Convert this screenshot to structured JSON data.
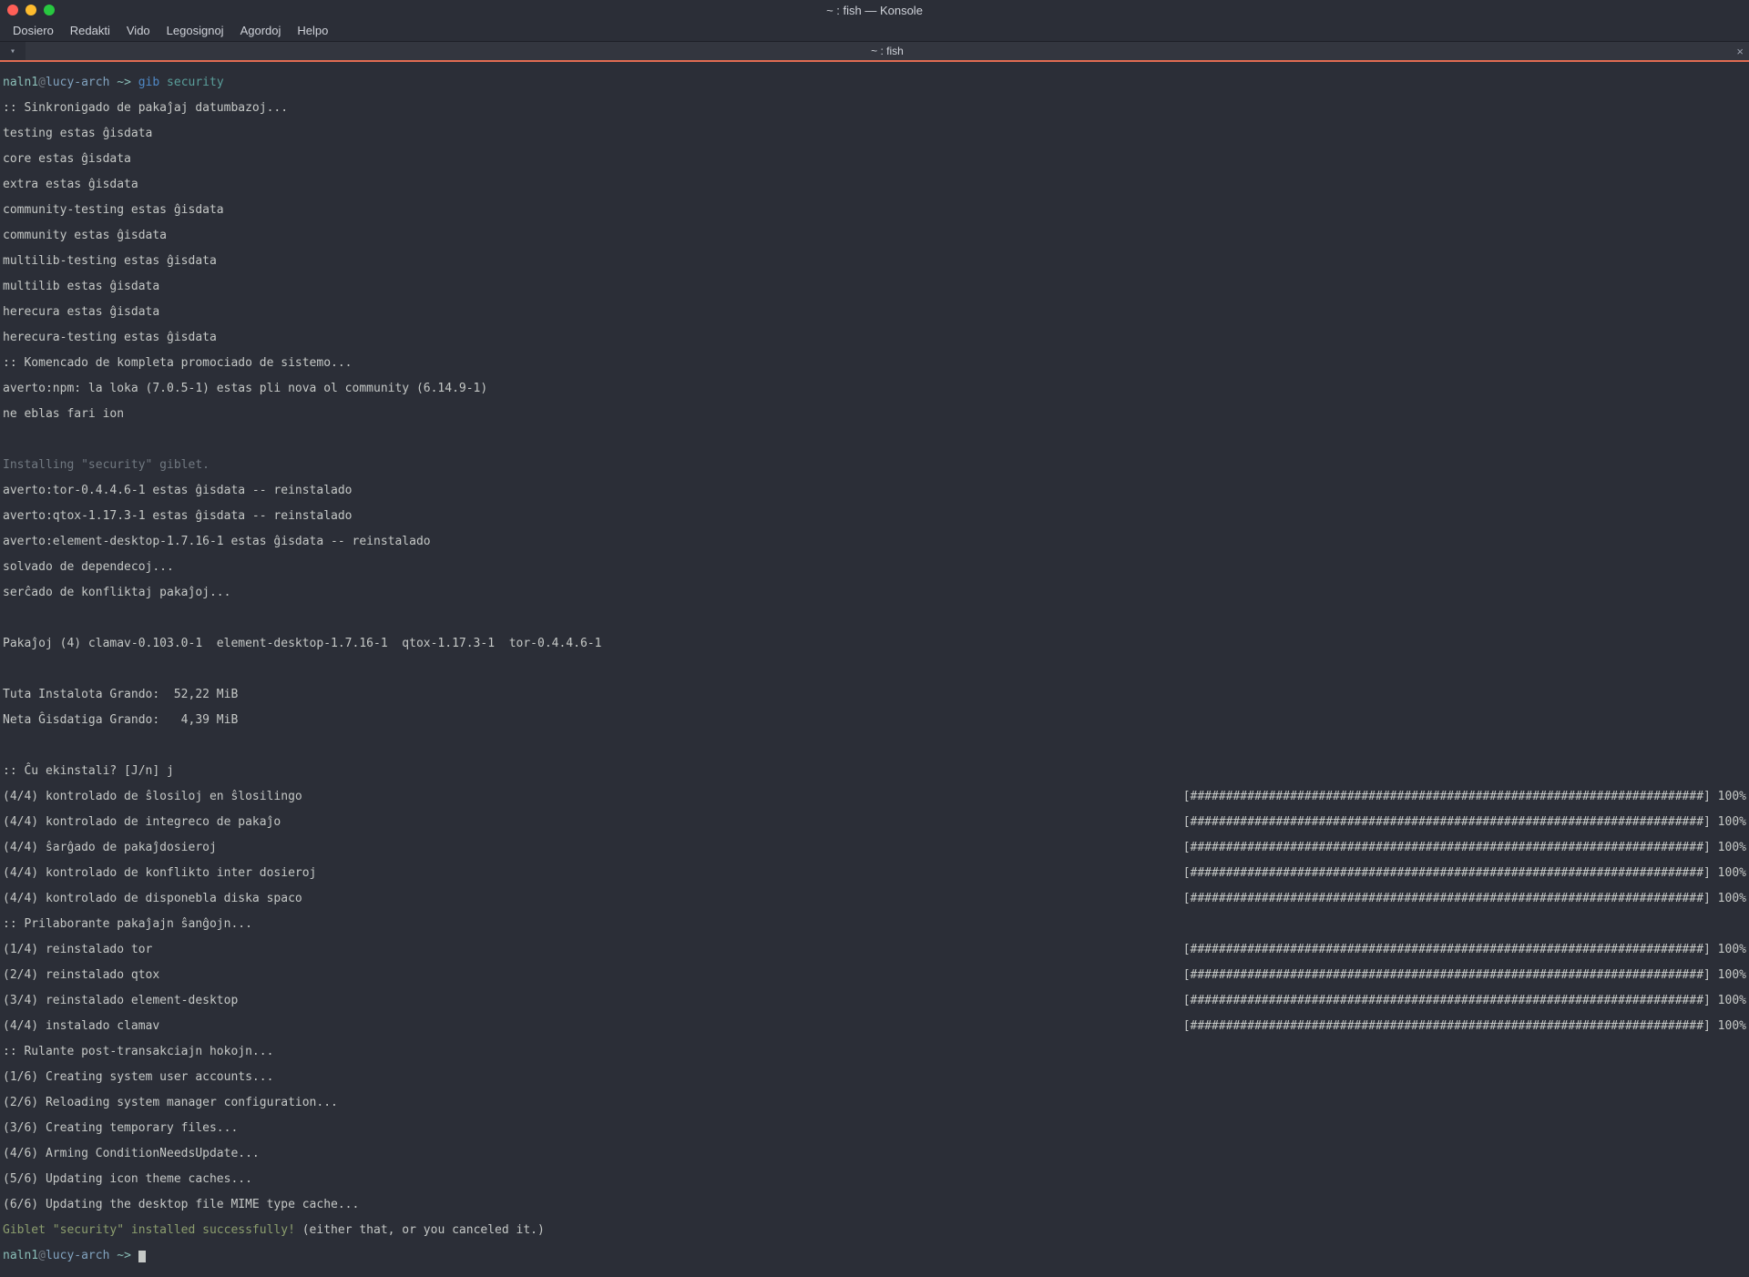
{
  "window": {
    "title": "~ : fish — Konsole"
  },
  "menubar": {
    "items": [
      "Dosiero",
      "Redakti",
      "Vido",
      "Legosignoj",
      "Agordoj",
      "Helpo"
    ]
  },
  "tabbar": {
    "newtab_glyph": "▾",
    "tab_label": "~ : fish",
    "close_glyph": "×"
  },
  "prompt": {
    "user": "naln1",
    "at": "@",
    "host": "lucy-arch",
    "sep": " ~> ",
    "cmd1": "gib",
    "cmd2": " security"
  },
  "output": {
    "sync": ":: Sinkronigado de pakaĵaj datumbazoj...",
    "repos": [
      "testing estas ĝisdata",
      "core estas ĝisdata",
      "extra estas ĝisdata",
      "community-testing estas ĝisdata",
      "community estas ĝisdata",
      "multilib-testing estas ĝisdata",
      "multilib estas ĝisdata",
      "herecura estas ĝisdata",
      "herecura-testing estas ĝisdata"
    ],
    "upgradestart": ":: Komencado de kompleta promociado de sistemo...",
    "npmwarn": "averto:npm: la loka (7.0.5-1) estas pli nova ol community (6.14.9-1)",
    "nothing": "ne eblas fari ion",
    "installing_header": "Installing \"security\" giblet.",
    "warn_tor": "averto:tor-0.4.4.6-1 estas ĝisdata -- reinstalado",
    "warn_qtox": "averto:qtox-1.17.3-1 estas ĝisdata -- reinstalado",
    "warn_element": "averto:element-desktop-1.7.16-1 estas ĝisdata -- reinstalado",
    "resolve": "solvado de dependecoj...",
    "conflicts": "serĉado de konfliktaj pakaĵoj...",
    "packages": "Pakaĵoj (4) clamav-0.103.0-1  element-desktop-1.7.16-1  qtox-1.17.3-1  tor-0.4.4.6-1",
    "totalsize": "Tuta Instalota Grando:  52,22 MiB",
    "netsize": "Neta Ĝisdatiga Grando:   4,39 MiB",
    "proceed": ":: Ĉu ekinstali? [J/n] j",
    "checks": [
      "(4/4) kontrolado de ŝlosiloj en ŝlosilingo",
      "(4/4) kontrolado de integreco de pakaĵo",
      "(4/4) ŝarĝado de pakaĵdosieroj",
      "(4/4) kontrolado de konflikto inter dosieroj",
      "(4/4) kontrolado de disponebla diska spaco"
    ],
    "processing": ":: Prilaborante pakaĵajn ŝanĝojn...",
    "installs": [
      "(1/4) reinstalado tor",
      "(2/4) reinstalado qtox",
      "(3/4) reinstalado element-desktop",
      "(4/4) instalado clamav"
    ],
    "hooks_header": ":: Rulante post-transakciajn hokojn...",
    "hooks": [
      "(1/6) Creating system user accounts...",
      "(2/6) Reloading system manager configuration...",
      "(3/6) Creating temporary files...",
      "(4/6) Arming ConditionNeedsUpdate...",
      "(5/6) Updating icon theme caches...",
      "(6/6) Updating the desktop file MIME type cache..."
    ],
    "success": "Giblet \"security\" installed successfully!",
    "success_tail": " (either that, or you canceled it.)",
    "progress_bar": "[########################################################################] 100%"
  }
}
